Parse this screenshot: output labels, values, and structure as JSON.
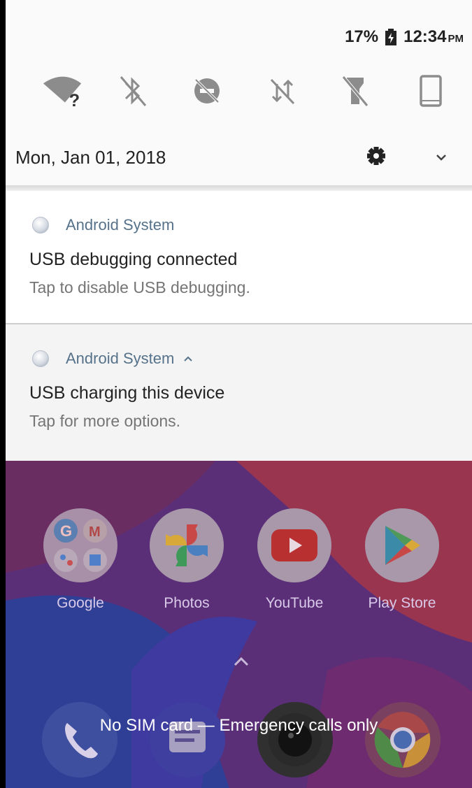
{
  "status_bar": {
    "battery": "17%",
    "time": "12:34",
    "ampm": "PM"
  },
  "quick_settings": {
    "tiles": [
      "wifi-unknown-icon",
      "bluetooth-off-icon",
      "do-not-disturb-off-icon",
      "mobile-data-off-icon",
      "flashlight-off-icon",
      "auto-rotate-icon"
    ],
    "date": "Mon, Jan 01, 2018"
  },
  "notifications": [
    {
      "app": "Android System",
      "title": "USB debugging connected",
      "text": "Tap to disable USB debugging."
    },
    {
      "app": "Android System",
      "title": "USB charging this device",
      "text": "Tap for more options."
    }
  ],
  "home": {
    "apps": [
      {
        "label": "Google"
      },
      {
        "label": "Photos"
      },
      {
        "label": "YouTube"
      },
      {
        "label": "Play Store"
      }
    ],
    "lock_message": "No SIM card — Emergency calls only"
  },
  "colors": {
    "shade_bg": "#fafafa",
    "app_name": "#56728a",
    "wallpaper": "#5a2f78"
  }
}
